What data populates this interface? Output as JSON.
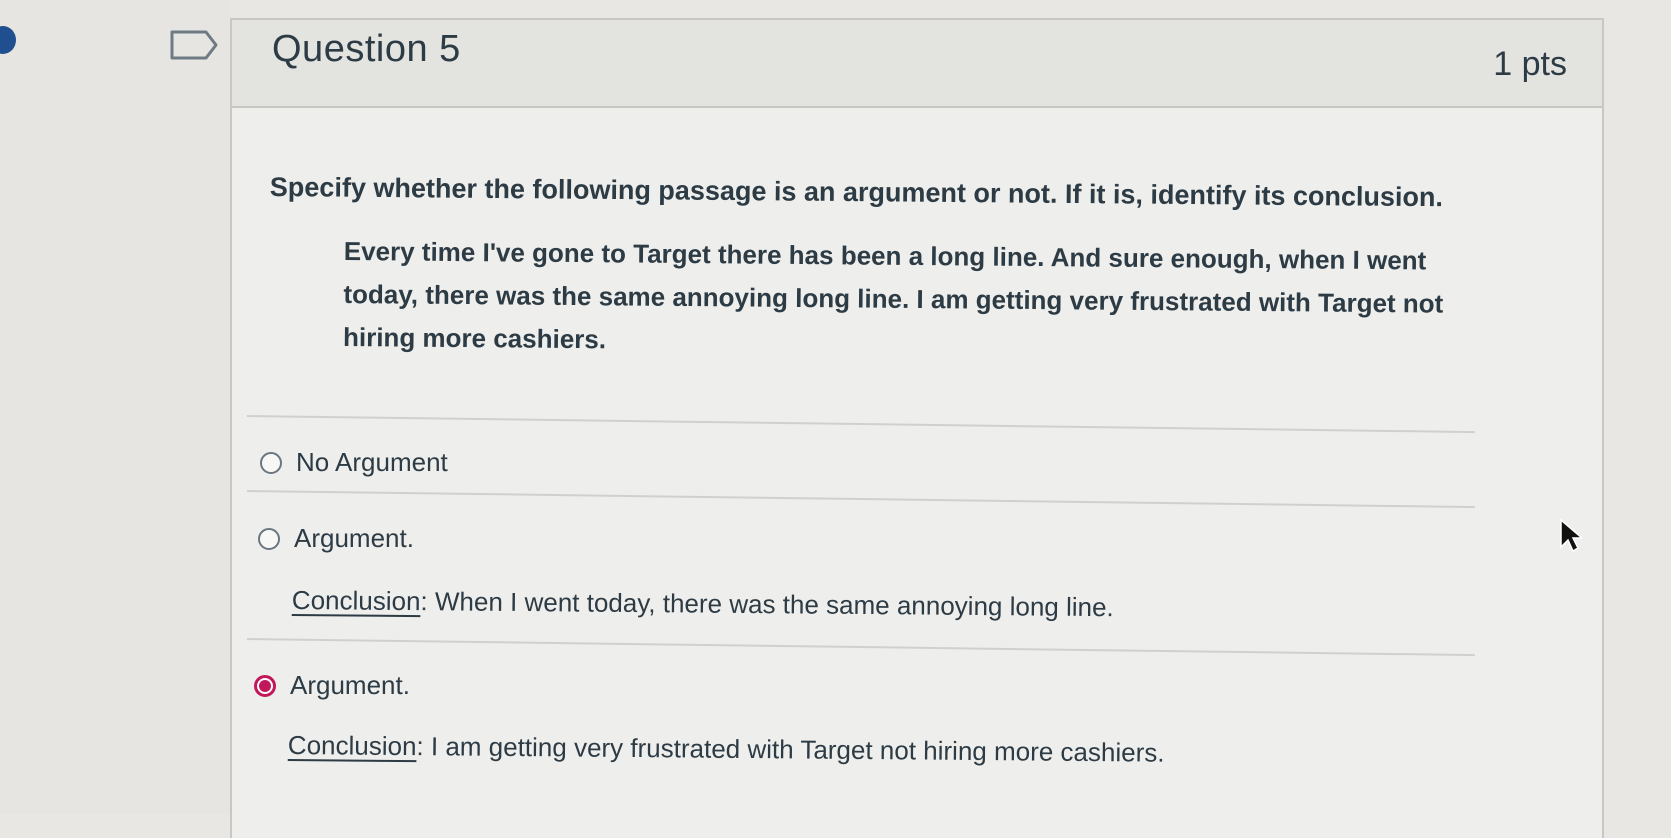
{
  "question": {
    "title": "Question 5",
    "points": "1 pts",
    "prompt": "Specify whether the following passage is an argument or not. If it is, identify its conclusion.",
    "passage": "Every time I've gone to Target there has been a long line. And sure enough, when I went today, there was the same annoying long line. I am getting very frustrated with Target not hiring more cashiers."
  },
  "answers": [
    {
      "label": "No Argument",
      "selected": false
    },
    {
      "label": "Argument.",
      "selected": false,
      "conclusion_label": "Conclusion",
      "conclusion_text": ": When I went today, there was the same annoying long line."
    },
    {
      "label": "Argument.",
      "selected": true,
      "conclusion_label": "Conclusion",
      "conclusion_text": ": I am getting very frustrated with Target not hiring more cashiers."
    }
  ],
  "colors": {
    "accent": "#c2185b",
    "text": "#2d3b45",
    "card_background": "#eeeeec",
    "header_background": "#e3e3e0",
    "navigation_badge": "#1f4f8f"
  },
  "icons": {
    "flag": "flag-question-icon",
    "pointer": "mouse-pointer-icon",
    "navigation": "navigation-badge"
  }
}
